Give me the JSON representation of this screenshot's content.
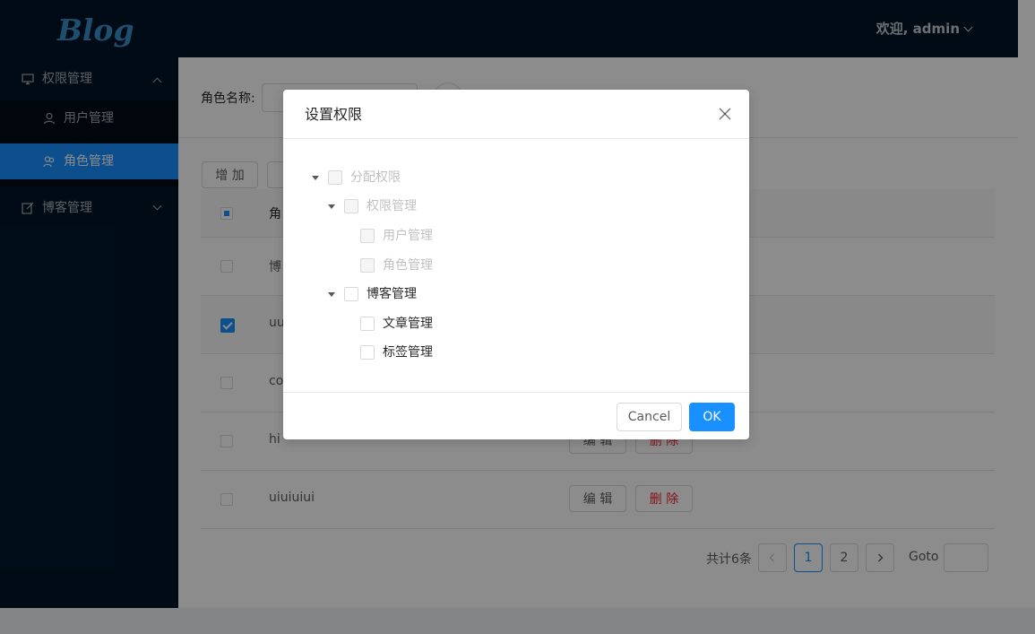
{
  "app": {
    "logo": "Blog",
    "user_greeting": "欢迎, admin"
  },
  "sidebar": {
    "groups": [
      {
        "label": "权限管理",
        "icon": "desktop-icon",
        "expanded": true,
        "items": [
          {
            "label": "用户管理",
            "icon": "user-icon",
            "active": false
          },
          {
            "label": "角色管理",
            "icon": "team-icon",
            "active": true
          }
        ]
      },
      {
        "label": "博客管理",
        "icon": "edit-icon",
        "expanded": false,
        "items": []
      }
    ]
  },
  "search": {
    "label": "角色名称:",
    "value": ""
  },
  "toolbar": {
    "add_label": "增 加"
  },
  "table": {
    "header_partial": "角",
    "rows": [
      {
        "name": "博",
        "checked": false,
        "highlighted": false
      },
      {
        "name": "uu",
        "checked": true,
        "highlighted": true
      },
      {
        "name": "co",
        "checked": false,
        "highlighted": false
      },
      {
        "name": "hi",
        "checked": false,
        "highlighted": false,
        "edit": "编 辑",
        "delete": "删 除"
      },
      {
        "name": "uiuiuiui",
        "checked": false,
        "highlighted": false,
        "edit": "编 辑",
        "delete": "删 除"
      }
    ]
  },
  "pagination": {
    "total_text": "共计6条",
    "pages": [
      "1",
      "2"
    ],
    "current": "1",
    "goto_label": "Goto"
  },
  "modal": {
    "title": "设置权限",
    "tree": [
      {
        "label": "分配权限",
        "level": 0,
        "expandable": true,
        "disabled": true
      },
      {
        "label": "权限管理",
        "level": 1,
        "expandable": true,
        "disabled": true
      },
      {
        "label": "用户管理",
        "level": 2,
        "expandable": false,
        "disabled": true
      },
      {
        "label": "角色管理",
        "level": 2,
        "expandable": false,
        "disabled": true
      },
      {
        "label": "博客管理",
        "level": 1,
        "expandable": true,
        "disabled": false
      },
      {
        "label": "文章管理",
        "level": 2,
        "expandable": false,
        "disabled": false
      },
      {
        "label": "标签管理",
        "level": 2,
        "expandable": false,
        "disabled": false
      }
    ],
    "cancel_label": "Cancel",
    "ok_label": "OK"
  },
  "colors": {
    "sider_bg": "#001529",
    "primary": "#1890ff",
    "danger": "#f5222d"
  }
}
